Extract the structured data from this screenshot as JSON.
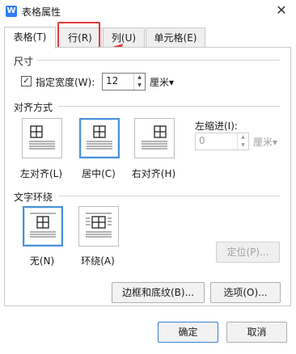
{
  "window": {
    "title": "表格属性",
    "app_icon_letter": "W"
  },
  "tabs": [
    {
      "label": "表格(T)",
      "active": true
    },
    {
      "label": "行(R)",
      "active": false
    },
    {
      "label": "列(U)",
      "active": false
    },
    {
      "label": "单元格(E)",
      "active": false
    }
  ],
  "size": {
    "section_label": "尺寸",
    "width_checkbox_label": "指定宽度(W):",
    "width_checked": true,
    "width_value": "12",
    "width_unit": "厘米▾"
  },
  "alignment": {
    "section_label": "对齐方式",
    "options": [
      {
        "label": "左对齐(L)",
        "selected": false
      },
      {
        "label": "居中(C)",
        "selected": true
      },
      {
        "label": "右对齐(H)",
        "selected": false
      }
    ],
    "indent_label": "左缩进(I):",
    "indent_value": "0",
    "indent_unit": "厘米▾"
  },
  "wrapping": {
    "section_label": "文字环绕",
    "options": [
      {
        "label": "无(N)",
        "selected": true
      },
      {
        "label": "环绕(A)",
        "selected": false
      }
    ],
    "position_button": "定位(P)..."
  },
  "buttons": {
    "borders_shading": "边框和底纹(B)...",
    "options": "选项(O)...",
    "ok": "确定",
    "cancel": "取消"
  },
  "colors": {
    "accent": "#4a90d9",
    "highlight": "#e53a3a"
  }
}
